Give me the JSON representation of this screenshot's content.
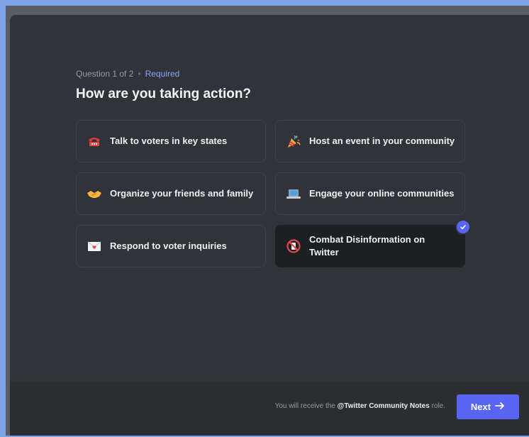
{
  "question": {
    "progress": "Question 1 of 2",
    "separator": "•",
    "required": "Required",
    "title": "How are you taking action?"
  },
  "options": [
    {
      "label": "Talk to voters in key states",
      "icon": "telephone-icon",
      "selected": false
    },
    {
      "label": "Host an event in your community",
      "icon": "party-popper-icon",
      "selected": false
    },
    {
      "label": "Organize your friends and family",
      "icon": "handshake-icon",
      "selected": false
    },
    {
      "label": "Engage your online communities",
      "icon": "laptop-icon",
      "selected": false
    },
    {
      "label": "Respond to voter inquiries",
      "icon": "love-letter-icon",
      "selected": false
    },
    {
      "label": "Combat Disinformation on Twitter",
      "icon": "no-mobile-phones-icon",
      "selected": true
    }
  ],
  "footer": {
    "role_prefix": "You will receive the",
    "role_name": "@Twitter Community Notes",
    "role_suffix": "role.",
    "next_label": "Next"
  },
  "colors": {
    "accent": "#5865f2",
    "required": "#8ea1ff",
    "modal_bg": "#313338",
    "footer_bg": "#2b2d31"
  }
}
